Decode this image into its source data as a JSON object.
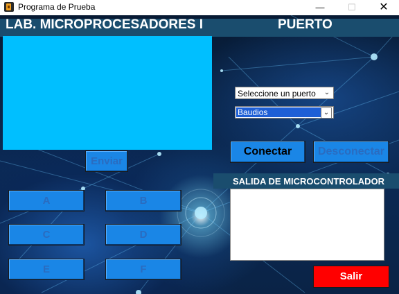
{
  "window": {
    "title": "Programa de Prueba",
    "minimize_glyph": "—",
    "maximize_glyph": "☐",
    "close_glyph": "✕",
    "icon": "app-icon"
  },
  "header": {
    "title": "LAB. MICROPROCESADORES I",
    "port_section": "PUERTO"
  },
  "port": {
    "selected": "Seleccione un puerto"
  },
  "baud": {
    "selected": "Baudios"
  },
  "buttons": {
    "enviar": "Enviar",
    "a": "A",
    "b": "B",
    "c": "C",
    "d": "D",
    "e": "E",
    "f": "F",
    "conectar": "Conectar",
    "desconectar": "Desconectar",
    "salir": "Salir"
  },
  "output": {
    "label": "SALIDA DE MICROCONTROLADOR",
    "value": ""
  },
  "colors": {
    "header_bar": "#1a4d6e",
    "panel": "#00bfff",
    "button": "#1a86e6",
    "exit_button": "#ff0000"
  }
}
